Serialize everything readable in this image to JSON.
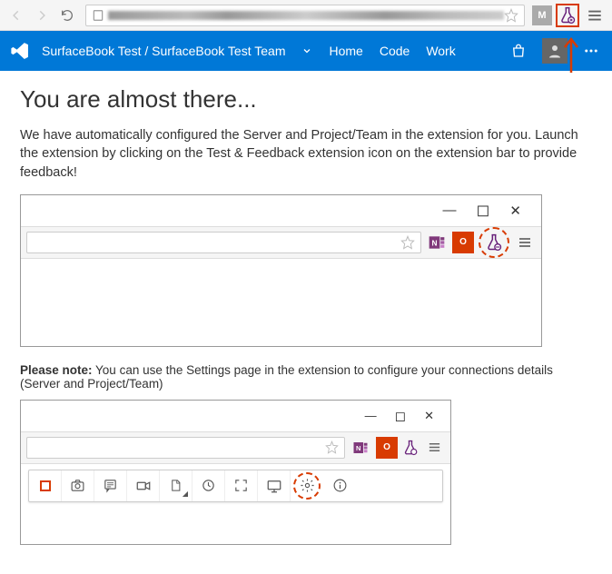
{
  "chrome": {
    "extension_m": "M",
    "address": "(obscured URL)"
  },
  "blueBar": {
    "teamPath": "SurfaceBook Test / SurfaceBook Test Team",
    "nav": {
      "home": "Home",
      "code": "Code",
      "work": "Work"
    }
  },
  "page": {
    "heading": "You are almost there...",
    "intro": "We have automatically configured the Server and Project/Team in the extension for you. Launch the extension by clicking on the Test & Feedback extension icon on the extension bar to provide feedback!",
    "noteLabel": "Please note:",
    "noteBody": " You can use the Settings page in the extension to configure your connections details (Server and Project/Team)"
  },
  "mock": {
    "officeLabel": "O",
    "minimize": "—",
    "maximize": "◻",
    "close": "✕"
  }
}
